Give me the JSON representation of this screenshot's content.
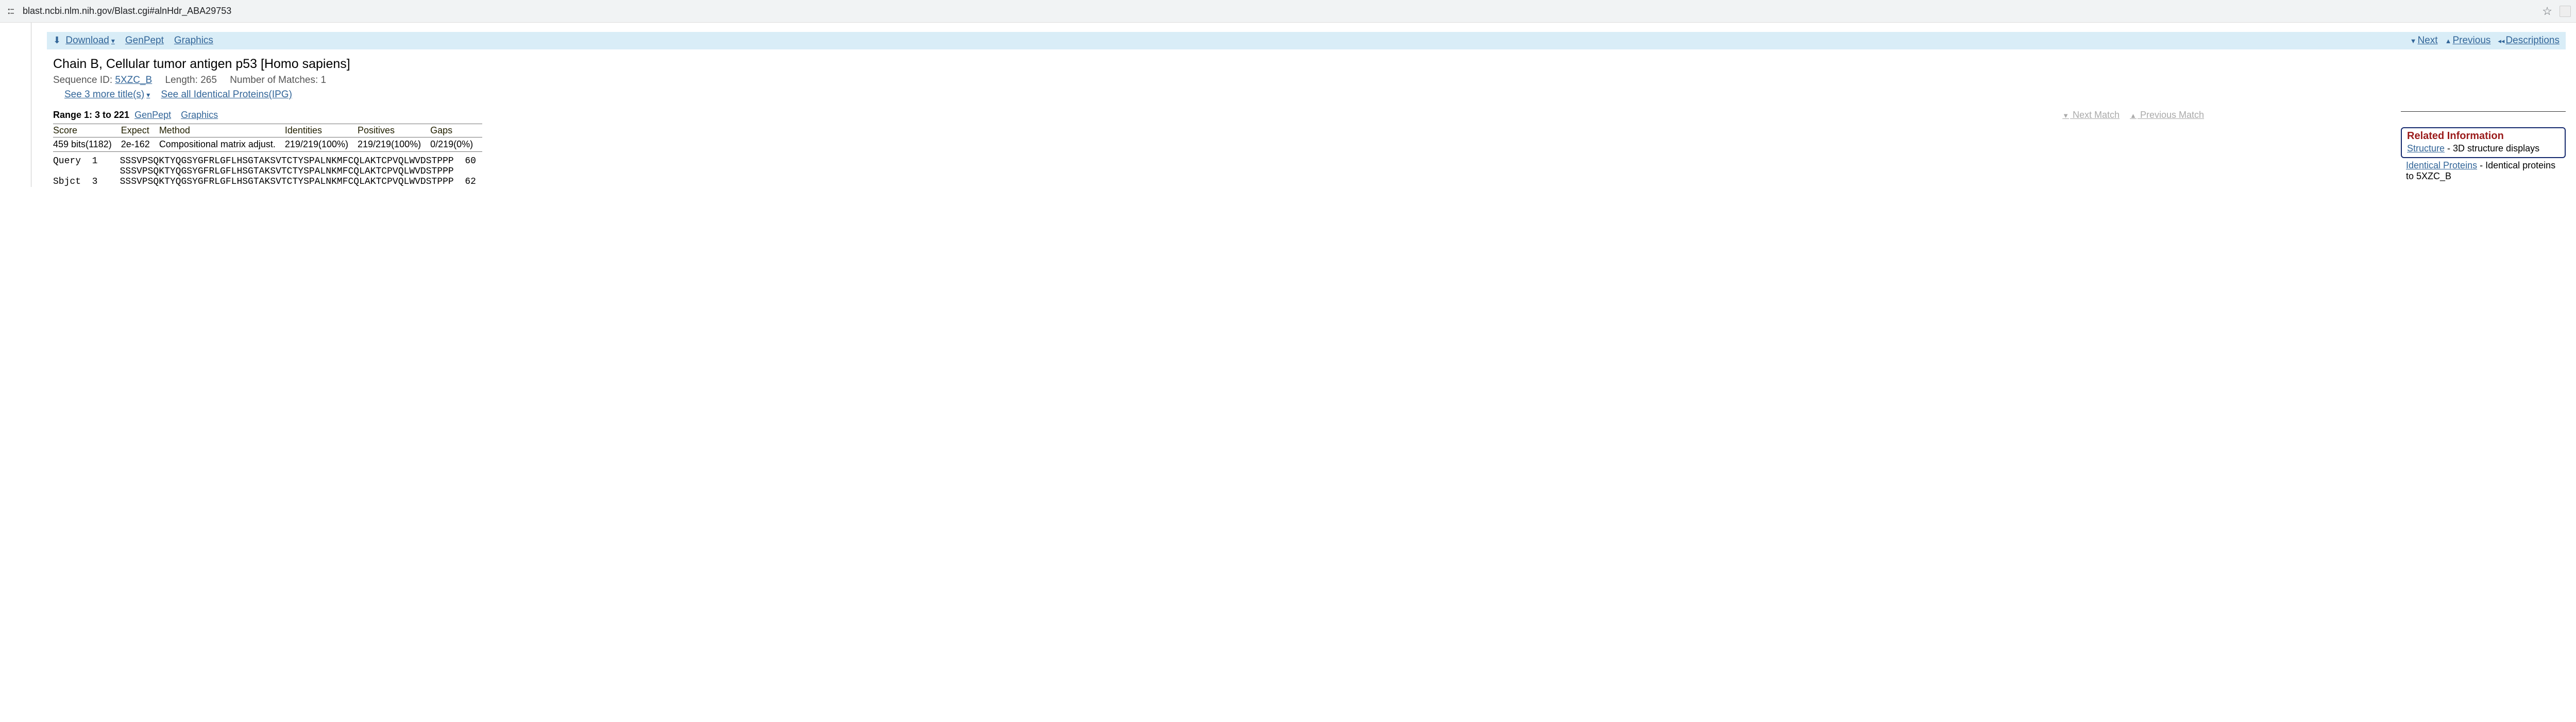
{
  "browser": {
    "url": "blast.ncbi.nlm.nih.gov/Blast.cgi#alnHdr_ABA29753"
  },
  "toolbar": {
    "download_label": "Download",
    "genpept_label": "GenPept",
    "graphics_label": "Graphics",
    "next_label": "Next",
    "previous_label": "Previous",
    "descriptions_label": "Descriptions"
  },
  "header": {
    "title": "Chain B, Cellular tumor antigen p53 [Homo sapiens]",
    "seq_id_label": "Sequence ID:",
    "seq_id": "5XZC_B",
    "length_label": "Length:",
    "length": "265",
    "matches_label": "Number of Matches:",
    "matches": "1",
    "more_titles": "See 3 more title(s)",
    "ipg": "See all Identical Proteins(IPG)"
  },
  "range": {
    "label": "Range 1: 3 to 221",
    "genpept": "GenPept",
    "graphics": "Graphics",
    "next_match": "Next Match",
    "prev_match": "Previous Match"
  },
  "stats": {
    "headers": {
      "score": "Score",
      "expect": "Expect",
      "method": "Method",
      "identities": "Identities",
      "positives": "Positives",
      "gaps": "Gaps"
    },
    "values": {
      "score": "459 bits(1182)",
      "expect": "2e-162",
      "method": "Compositional matrix adjust.",
      "identities": "219/219(100%)",
      "positives": "219/219(100%)",
      "gaps": "0/219(0%)"
    }
  },
  "alignment": {
    "line1": "Query  1    SSSVPSQKTYQGSYGFRLGFLHSGTAKSVTCTYSPALNKMFCQLAKTCPVQLWVDSTPPP  60",
    "line2": "            SSSVPSQKTYQGSYGFRLGFLHSGTAKSVTCTYSPALNKMFCQLAKTCPVQLWVDSTPPP",
    "line3": "Sbjct  3    SSSVPSQKTYQGSYGFRLGFLHSGTAKSVTCTYSPALNKMFCQLAKTCPVQLWVDSTPPP  62"
  },
  "related": {
    "title": "Related Information",
    "structure_link": "Structure",
    "structure_desc": " - 3D structure displays",
    "ip_link": "Identical Proteins",
    "ip_desc": " - Identical proteins to 5XZC_B"
  }
}
